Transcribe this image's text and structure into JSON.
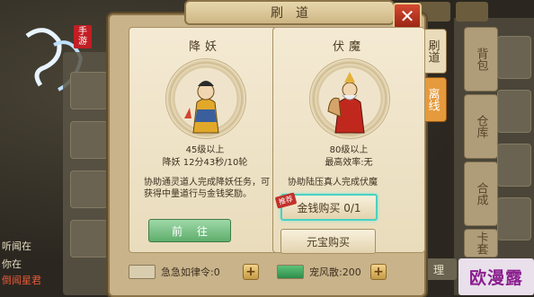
{
  "dialog": {
    "title": "刷道",
    "close_label": "✕"
  },
  "tabs": [
    {
      "label": "刷道"
    },
    {
      "label": "离线"
    }
  ],
  "left_panel": {
    "title": "降妖",
    "level_text": "45级以上",
    "progress_text": "降妖 12分43秒/10轮",
    "description": "协助通灵道人完成降妖任务，可获得中量道行与金钱奖励。",
    "go_button": "前往"
  },
  "right_panel": {
    "title": "伏魔",
    "level_text": "80级以上",
    "efficiency_text": "最高效率:无",
    "description": "协助陆压真人完成伏魔",
    "flag": "推荐",
    "gold_buy": "金钱购买 0/1",
    "ingot_buy": "元宝购买"
  },
  "bottom": {
    "left_label": "急急如律令:0",
    "right_label": "宠风散:200"
  },
  "background": {
    "logo_badge": "手游",
    "right_tabs": [
      "背包",
      "仓库",
      "合成",
      "卡套"
    ],
    "bottom_lines": [
      "听闻在",
      "你在",
      "倒闻星君"
    ],
    "right_bottom_button": "理"
  },
  "watermark": "欧漫露",
  "colors": {
    "accent_green": "#5fae6c",
    "close_red": "#c23a26",
    "tab_orange": "#e59a3c"
  }
}
